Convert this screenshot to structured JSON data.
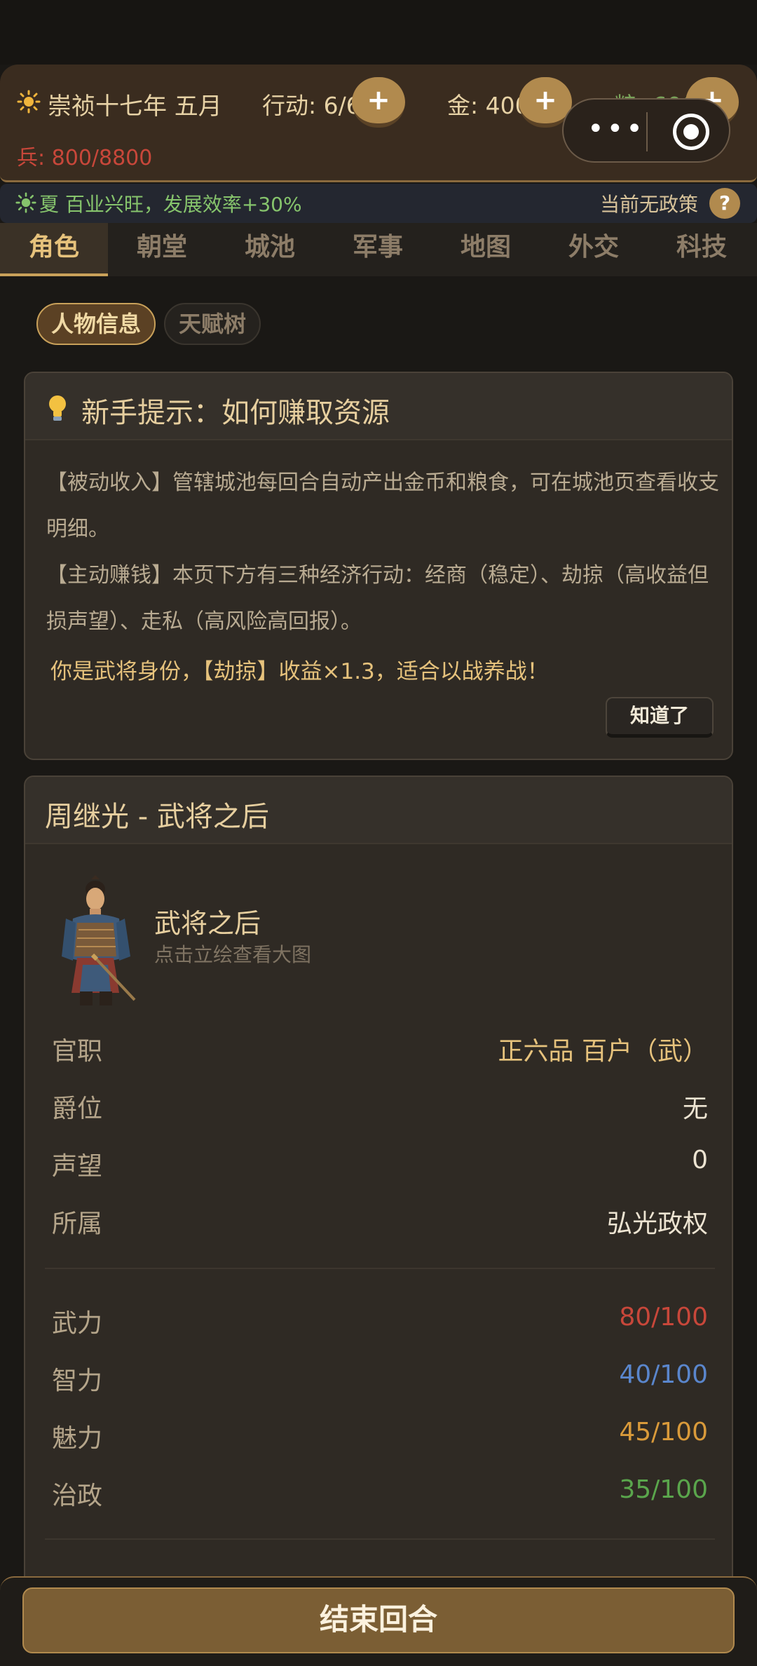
{
  "topbar": {
    "date": "崇祯十七年 五月",
    "actions": "行动: 6/6",
    "gold": "金: 400",
    "grain": "粮: 600",
    "soldiers": "兵: 800/8800",
    "plus_label": "+"
  },
  "capsule": {
    "more_label": "•••"
  },
  "season": {
    "text": "夏 百业兴旺，发展效率+30%",
    "policy": "当前无政策",
    "help_label": "?"
  },
  "tabs": [
    "角色",
    "朝堂",
    "城池",
    "军事",
    "地图",
    "外交",
    "科技"
  ],
  "active_tab": "角色",
  "subtabs": {
    "profile": "人物信息",
    "talent": "天赋树"
  },
  "tip": {
    "title": "新手提示：如何赚取资源",
    "para1": "【被动收入】管辖城池每回合自动产出金币和粮食，可在城池页查看收支明细。",
    "para2": "【主动赚钱】本页下方有三种经济行动：经商（稳定）、劫掠（高收益但损声望）、走私（高风险高回报）。",
    "highlight": "你是武将身份，【劫掠】收益×1.3，适合以战养战！",
    "button": "知道了"
  },
  "character": {
    "title": "周继光 - 武将之后",
    "identity": "武将之后",
    "portrait_hint": "点击立绘查看大图",
    "info": [
      {
        "label": "官职",
        "value": "正六品 百户（武）",
        "color": "#e6c27c"
      },
      {
        "label": "爵位",
        "value": "无",
        "color": "#ede4d2"
      },
      {
        "label": "声望",
        "value": "0",
        "color": "#ede4d2"
      },
      {
        "label": "所属",
        "value": "弘光政权",
        "color": "#ede4d2"
      }
    ],
    "attributes": [
      {
        "label": "武力",
        "value": "80/100",
        "color": "#c8473a"
      },
      {
        "label": "智力",
        "value": "40/100",
        "color": "#5a86cc"
      },
      {
        "label": "魅力",
        "value": "45/100",
        "color": "#d99a3a"
      },
      {
        "label": "治政",
        "value": "35/100",
        "color": "#5aa64c"
      }
    ]
  },
  "bottom": {
    "end_turn": "结束回合"
  }
}
